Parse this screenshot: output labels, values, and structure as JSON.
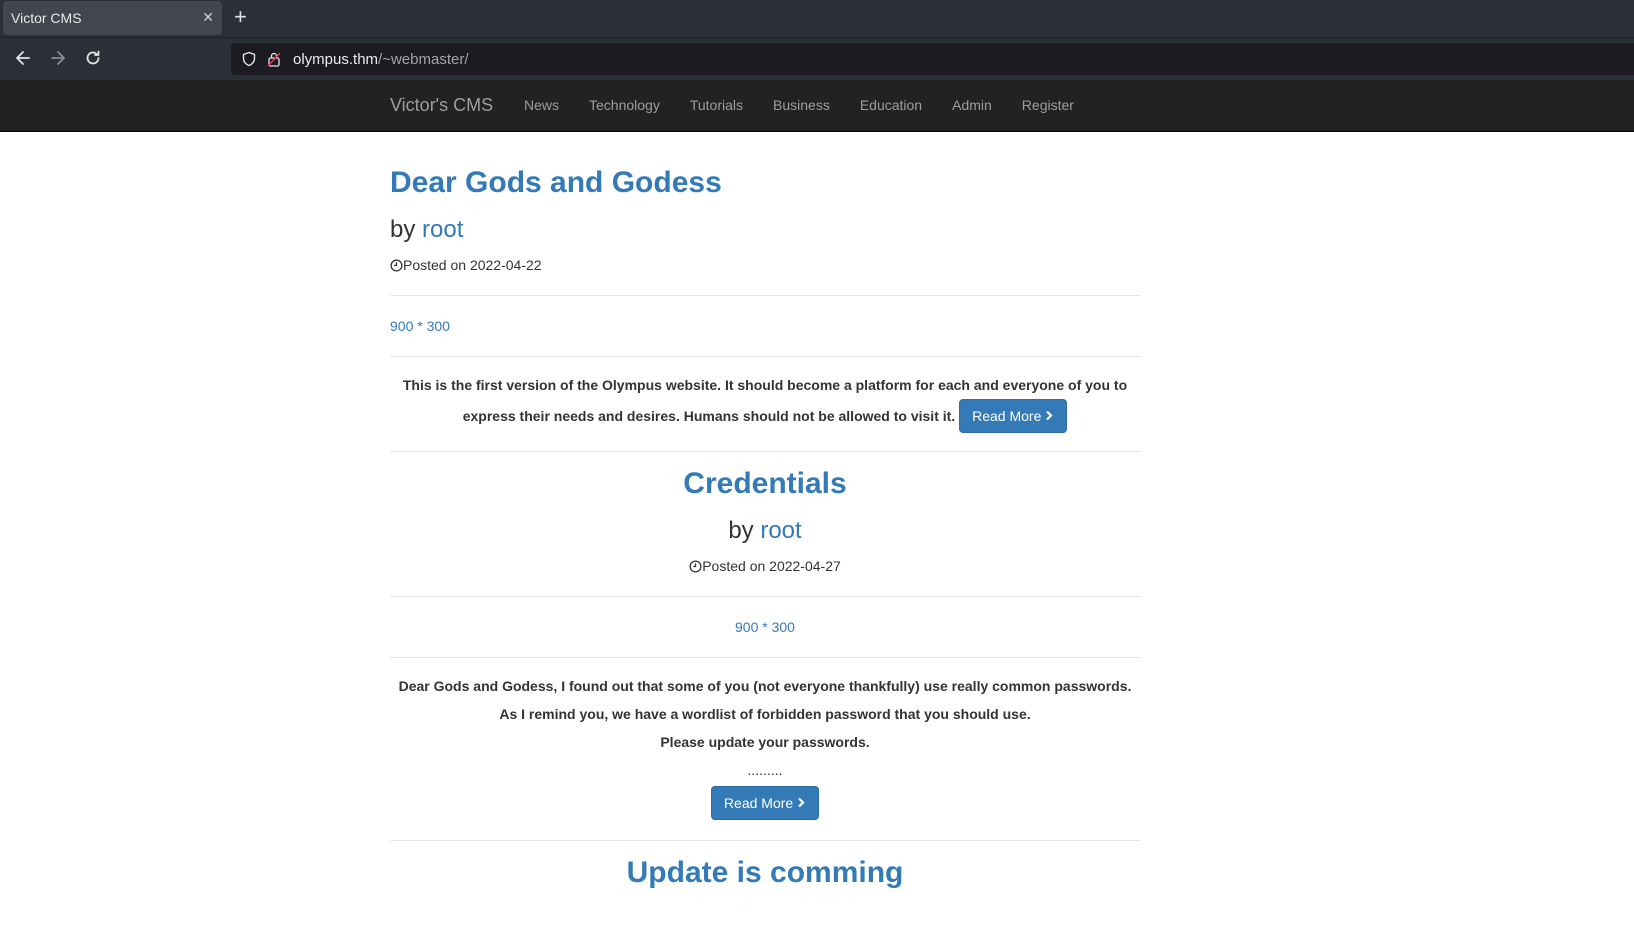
{
  "browser": {
    "tab_title": "Victor CMS",
    "tab_close": "✕",
    "new_tab": "+",
    "url_host": "olympus.thm",
    "url_path": "/~webmaster/"
  },
  "site": {
    "brand": "Victor's CMS",
    "menu": [
      "News",
      "Technology",
      "Tutorials",
      "Business",
      "Education",
      "Admin",
      "Register"
    ]
  },
  "posts": [
    {
      "title": "Dear Gods and Godess",
      "by": "by ",
      "author": "root",
      "posted": "Posted on 2022-04-22",
      "image_alt": "900 * 300",
      "body_lines": [
        "This is the first version of the Olympus website. It should become a platform for each and everyone of you to express their needs and desires. Humans should not be allowed to visit it."
      ],
      "read_more": "Read More"
    },
    {
      "title": "Credentials",
      "by": "by ",
      "author": "root",
      "posted": "Posted on 2022-04-27",
      "image_alt": "900 * 300",
      "body_lines": [
        "Dear Gods and Godess, I found out that some of you (not everyone thankfully) use really common passwords.",
        "As I remind you, we have a wordlist of forbidden password that you should use.",
        "Please update your passwords."
      ],
      "dots": ".........",
      "read_more": "Read More"
    },
    {
      "title": "Update is comming"
    }
  ],
  "colors": {
    "link": "#337ab7",
    "navbar": "#222222",
    "button": "#337ab7"
  }
}
